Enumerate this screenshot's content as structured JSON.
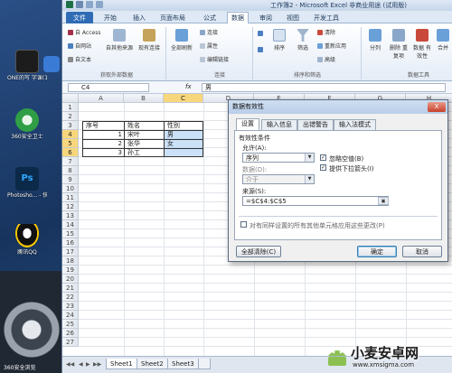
{
  "desktop": {
    "icons": [
      {
        "label": "ONE的写 字课(1)",
        "color": "#1c1c1c"
      },
      {
        "label": "我的 视",
        "color": "#3a7bd5"
      },
      {
        "label": "360安全卫士",
        "color": "#2f9e44"
      },
      {
        "label": "Photosho... - 快捷方式",
        "color": "#0b2a4a"
      },
      {
        "label": "腾讯QQ",
        "color": "#111"
      }
    ],
    "bottom_label": "360安全浏览"
  },
  "window": {
    "title": "工作簿2 - Microsoft Excel 非商业用途 (试用版)",
    "menu_tabs": [
      "文件",
      "开始",
      "插入",
      "页面布局",
      "公式",
      "数据",
      "审阅",
      "视图",
      "开发工具"
    ],
    "active_tab": "数据"
  },
  "ribbon": {
    "external": {
      "items": [
        "自 Access",
        "自网站",
        "自文本"
      ],
      "other": "自其他来源",
      "existing": "现有连接",
      "group": "获取外部数据"
    },
    "connections": {
      "refresh": "全部刷新",
      "items": [
        "连接",
        "属性",
        "编辑链接"
      ],
      "group": "连接"
    },
    "sort": {
      "sort_btn": "排序",
      "filter_btn": "筛选",
      "items": [
        "清除",
        "重新应用",
        "高级"
      ],
      "group": "排序和筛选"
    },
    "tools": {
      "items": [
        "分列",
        "删除 重复项",
        "数据 有效性",
        "合并"
      ],
      "group": "数据工具"
    }
  },
  "formula_bar": {
    "cell_ref": "C4",
    "fx": "fx",
    "value": "男"
  },
  "sheet": {
    "columns": [
      "A",
      "B",
      "C",
      "D",
      "E",
      "F",
      "G",
      "H",
      "I"
    ],
    "rows": [
      "1",
      "2",
      "3",
      "4",
      "5",
      "6",
      "7",
      "8",
      "9",
      "10",
      "11",
      "12",
      "13",
      "14",
      "15",
      "16",
      "17",
      "18",
      "19",
      "20",
      "21",
      "22",
      "23",
      "24",
      "25",
      "26",
      "27"
    ],
    "headers": [
      "序号",
      "姓名",
      "性别"
    ],
    "data": [
      {
        "no": "1",
        "name": "宋叶",
        "gender": "男"
      },
      {
        "no": "2",
        "name": "张华",
        "gender": "女"
      },
      {
        "no": "3",
        "name": "孙工",
        "gender": ""
      }
    ],
    "sheet_tabs": [
      "Sheet1",
      "Sheet2",
      "Sheet3"
    ]
  },
  "dialog": {
    "title": "数据有效性",
    "close": "X",
    "tabs": [
      "设置",
      "输入信息",
      "出错警告",
      "输入法模式"
    ],
    "section": "有效性条件",
    "allow_label": "允许(A):",
    "allow_value": "序列",
    "ignore_blank": "忽略空值(B)",
    "dropdown": "提供下拉箭头(I)",
    "data_label": "数据(D):",
    "data_value": "介于",
    "source_label": "来源(S):",
    "source_value": "=$C$4:$C$5",
    "apply_all": "对有同样设置的所有其他单元格应用这些更改(P)",
    "clear_all": "全部清除(C)",
    "ok": "确定",
    "cancel": "取消"
  },
  "watermark": {
    "name": "小麦安卓网",
    "url": "www.xmsigma.com"
  }
}
